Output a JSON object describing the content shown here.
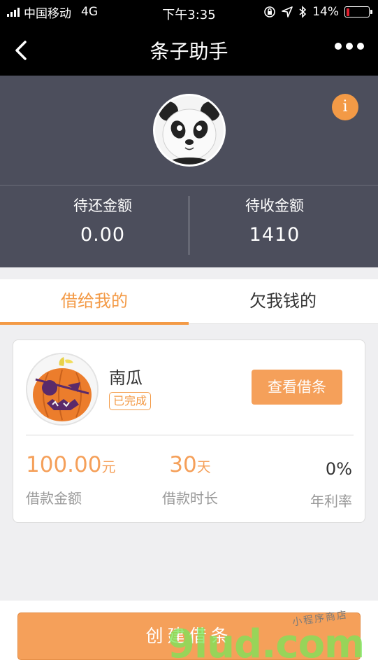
{
  "status_bar": {
    "carrier": "中国移动",
    "network": "4G",
    "time": "下午3:35",
    "battery_percent": "14%",
    "battery_level": 0.14,
    "battery_color": "#e0202f"
  },
  "nav": {
    "title": "条子助手",
    "back_icon": "chevron-left-icon",
    "more_icon": "more-dots-icon"
  },
  "header": {
    "avatar_icon": "panda-avatar",
    "info_label": "i",
    "pending_repay_label": "待还金额",
    "pending_repay_value": "0.00",
    "pending_receive_label": "待收金额",
    "pending_receive_value": "1410"
  },
  "tabs": [
    {
      "label": "借给我的",
      "active": true
    },
    {
      "label": "欠我钱的",
      "active": false
    }
  ],
  "loan_card": {
    "avatar_icon": "pumpkin-avatar",
    "name": "南瓜",
    "status_badge": "已完成",
    "view_button": "查看借条",
    "amount_value": "100.00",
    "amount_unit": "元",
    "amount_label": "借款金额",
    "duration_value": "30",
    "duration_unit": "天",
    "duration_label": "借款时长",
    "rate_value": "0%",
    "rate_label": "年利率"
  },
  "bottom": {
    "create_button": "创建借条"
  },
  "watermark": {
    "main": "9lud.com",
    "small": "小程序商店"
  },
  "colors": {
    "accent": "#f39a46",
    "header_bg": "#4c4e5c",
    "page_bg": "#efeff1"
  }
}
